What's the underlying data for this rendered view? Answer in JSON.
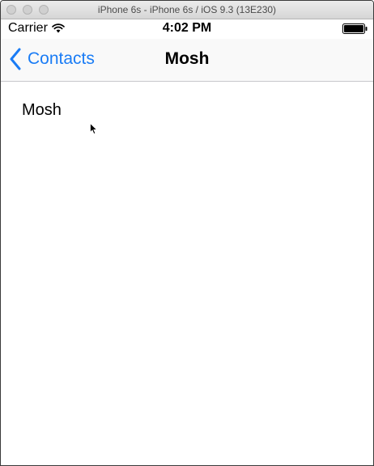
{
  "window": {
    "title": "iPhone 6s - iPhone 6s / iOS 9.3 (13E230)"
  },
  "status_bar": {
    "carrier": "Carrier",
    "time": "4:02 PM",
    "icons": [
      "wifi-icon",
      "battery-icon"
    ]
  },
  "nav_bar": {
    "back_label": "Contacts",
    "back_icon": "chevron-left-icon",
    "title": "Mosh"
  },
  "content": {
    "name": "Mosh"
  },
  "colors": {
    "accent": "#1a7cf5",
    "separator": "#c8c8cc",
    "nav_background": "#f9f9f9"
  }
}
